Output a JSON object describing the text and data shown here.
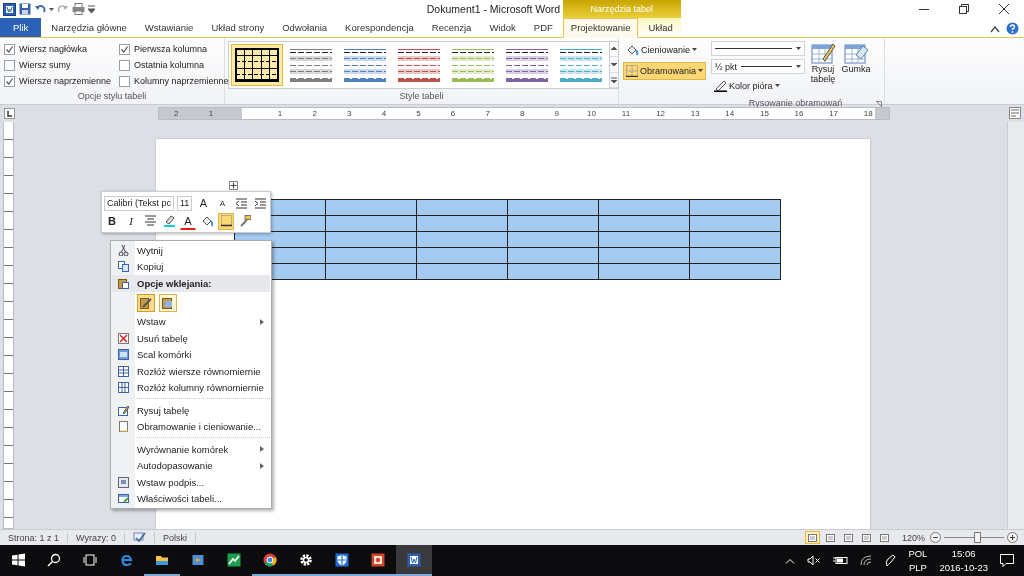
{
  "window": {
    "title": "Dokument1  -  Microsoft Word"
  },
  "context_tab_group": {
    "label": "Narzędzia tabel"
  },
  "tabs": [
    {
      "label": "Plik",
      "kind": "file",
      "selected": false
    },
    {
      "label": "Narzędzia główne",
      "kind": "main",
      "selected": false
    },
    {
      "label": "Wstawianie",
      "kind": "main",
      "selected": false
    },
    {
      "label": "Układ strony",
      "kind": "main",
      "selected": false
    },
    {
      "label": "Odwołania",
      "kind": "main",
      "selected": false
    },
    {
      "label": "Korespondencja",
      "kind": "main",
      "selected": false
    },
    {
      "label": "Recenzja",
      "kind": "main",
      "selected": false
    },
    {
      "label": "Widok",
      "kind": "main",
      "selected": false
    },
    {
      "label": "PDF",
      "kind": "main",
      "selected": false
    },
    {
      "label": "Projektowanie",
      "kind": "context",
      "selected": true
    },
    {
      "label": "Układ",
      "kind": "context",
      "selected": false
    }
  ],
  "ribbon": {
    "groups": [
      {
        "kind": "checkboxes",
        "label": "Opcje stylu tabeli",
        "items": [
          {
            "label": "Wiersz nagłówka",
            "checked": true
          },
          {
            "label": "Wiersz sumy",
            "checked": false
          },
          {
            "label": "Wiersze naprzemienne",
            "checked": true
          },
          {
            "label": "Pierwsza kolumna",
            "checked": true
          },
          {
            "label": "Ostatnia kolumna",
            "checked": false
          },
          {
            "label": "Kolumny naprzemienne",
            "checked": false
          }
        ]
      },
      {
        "kind": "gallery",
        "label": "Style tabeli",
        "styles": [
          {
            "kind": "grid",
            "color": "#000000",
            "selected": true
          },
          {
            "kind": "striped",
            "color": "#7f7f7f",
            "selected": false
          },
          {
            "kind": "striped",
            "color": "#4f81bd",
            "selected": false
          },
          {
            "kind": "striped",
            "color": "#c0504d",
            "selected": false
          },
          {
            "kind": "striped",
            "color": "#9bbb59",
            "selected": false
          },
          {
            "kind": "striped",
            "color": "#8064a2",
            "selected": false
          },
          {
            "kind": "striped",
            "color": "#4bacc6",
            "selected": false
          }
        ]
      },
      {
        "kind": "shading",
        "buttons": [
          {
            "label": "Cieniowanie",
            "kind": "shading",
            "selected": false
          },
          {
            "label": "Obramowania",
            "kind": "borders",
            "selected": true
          }
        ]
      },
      {
        "kind": "drawing",
        "label": "Rysowanie obramowań",
        "pen_weight": "½ pkt",
        "pen_color": "Kolor pióra",
        "buttons": [
          {
            "label": "Rysuj tabelę",
            "kind": "draw"
          },
          {
            "label": "Gumka",
            "kind": "eraser"
          }
        ]
      }
    ]
  },
  "ruler": {
    "labels": [
      "2",
      "1",
      "1",
      "2",
      "3",
      "4",
      "5",
      "6",
      "7",
      "8",
      "9",
      "10",
      "11",
      "12",
      "13",
      "14",
      "15",
      "16",
      "17",
      "18"
    ]
  },
  "table": {
    "rows": [
      {
        "cells": [
          {
            "selected": true
          },
          {
            "selected": true
          },
          {
            "selected": true
          },
          {
            "selected": true
          },
          {
            "selected": true
          },
          {
            "selected": true
          }
        ]
      },
      {
        "cells": [
          {
            "selected": true
          },
          {
            "selected": true
          },
          {
            "selected": true
          },
          {
            "selected": true
          },
          {
            "selected": true
          },
          {
            "selected": true
          }
        ]
      },
      {
        "cells": [
          {
            "selected": true
          },
          {
            "selected": true
          },
          {
            "selected": true
          },
          {
            "selected": true
          },
          {
            "selected": true
          },
          {
            "selected": true
          }
        ]
      },
      {
        "cells": [
          {
            "selected": true
          },
          {
            "selected": true
          },
          {
            "selected": true
          },
          {
            "selected": true
          },
          {
            "selected": true
          },
          {
            "selected": true
          }
        ]
      },
      {
        "cells": [
          {
            "selected": true
          },
          {
            "selected": true
          },
          {
            "selected": true
          },
          {
            "selected": true
          },
          {
            "selected": true
          },
          {
            "selected": true
          }
        ]
      }
    ]
  },
  "mini_toolbar": {
    "font": "Calibri (Tekst pc",
    "size": "11",
    "top_buttons": [
      {
        "kind": "grow",
        "label": "A"
      },
      {
        "kind": "shrink",
        "label": "A"
      },
      {
        "kind": "outdent"
      },
      {
        "kind": "indent"
      }
    ],
    "bottom_buttons": [
      {
        "kind": "bold",
        "label": "B",
        "selected": false
      },
      {
        "kind": "italic",
        "label": "I",
        "selected": false
      },
      {
        "kind": "center",
        "selected": false
      },
      {
        "kind": "highlight",
        "selected": false
      },
      {
        "kind": "font_color",
        "label": "A",
        "selected": false
      },
      {
        "kind": "shading",
        "selected": false
      },
      {
        "kind": "borders",
        "selected": true
      },
      {
        "kind": "painter",
        "selected": false
      }
    ]
  },
  "context_menu": {
    "items": [
      {
        "kind": "item",
        "label": "Wytnij",
        "submenu": false
      },
      {
        "kind": "item",
        "label": "Kopiuj",
        "submenu": false
      },
      {
        "kind": "header",
        "label": "Opcje wklejania:"
      },
      {
        "kind": "paste_options",
        "options": [
          {
            "selected": true
          },
          {
            "selected": false
          }
        ]
      },
      {
        "kind": "item",
        "label": "Wstaw",
        "submenu": true
      },
      {
        "kind": "item",
        "label": "Usuń tabelę",
        "submenu": false
      },
      {
        "kind": "item",
        "label": "Scal komórki",
        "submenu": false
      },
      {
        "kind": "item",
        "label": "Rozłóż wiersze równomiernie",
        "submenu": false
      },
      {
        "kind": "item",
        "label": "Rozłóż kolumny równomiernie",
        "submenu": false
      },
      {
        "kind": "separator"
      },
      {
        "kind": "item",
        "label": "Rysuj tabelę",
        "submenu": false
      },
      {
        "kind": "item",
        "label": "Obramowanie i cieniowanie...",
        "submenu": false
      },
      {
        "kind": "separator"
      },
      {
        "kind": "item",
        "label": "Wyrównanie komórek",
        "submenu": true
      },
      {
        "kind": "item",
        "label": "Autodopasowanie",
        "submenu": true
      },
      {
        "kind": "item",
        "label": "Wstaw podpis...",
        "submenu": false
      },
      {
        "kind": "item",
        "label": "Właściwości tabeli...",
        "submenu": false
      }
    ]
  },
  "status_bar": {
    "page": "Strona: 1 z 1",
    "words": "Wyrazy: 0",
    "language": "Polski",
    "views": [
      {
        "selected": true
      },
      {
        "selected": false
      },
      {
        "selected": false
      },
      {
        "selected": false
      },
      {
        "selected": false
      }
    ],
    "zoom": "120%",
    "level": 0.55
  },
  "taskbar": {
    "apps": [
      {
        "kind": "start",
        "running": false,
        "selected": false
      },
      {
        "kind": "search",
        "running": false,
        "selected": false
      },
      {
        "kind": "taskview",
        "running": false,
        "selected": false
      },
      {
        "kind": "browser",
        "running": false,
        "selected": false
      },
      {
        "kind": "folder",
        "running": true,
        "selected": false
      },
      {
        "kind": "player",
        "running": false,
        "selected": false
      },
      {
        "kind": "chart",
        "running": false,
        "selected": false
      },
      {
        "kind": "chrome",
        "running": true,
        "selected": false
      },
      {
        "kind": "gear",
        "running": true,
        "selected": false
      },
      {
        "kind": "shield",
        "running": true,
        "selected": false
      },
      {
        "kind": "slides",
        "running": true,
        "selected": false
      },
      {
        "kind": "word",
        "running": true,
        "selected": true
      }
    ],
    "language": [
      "POL",
      "PLP"
    ],
    "time": "15:06",
    "date": "2016-10-23"
  }
}
